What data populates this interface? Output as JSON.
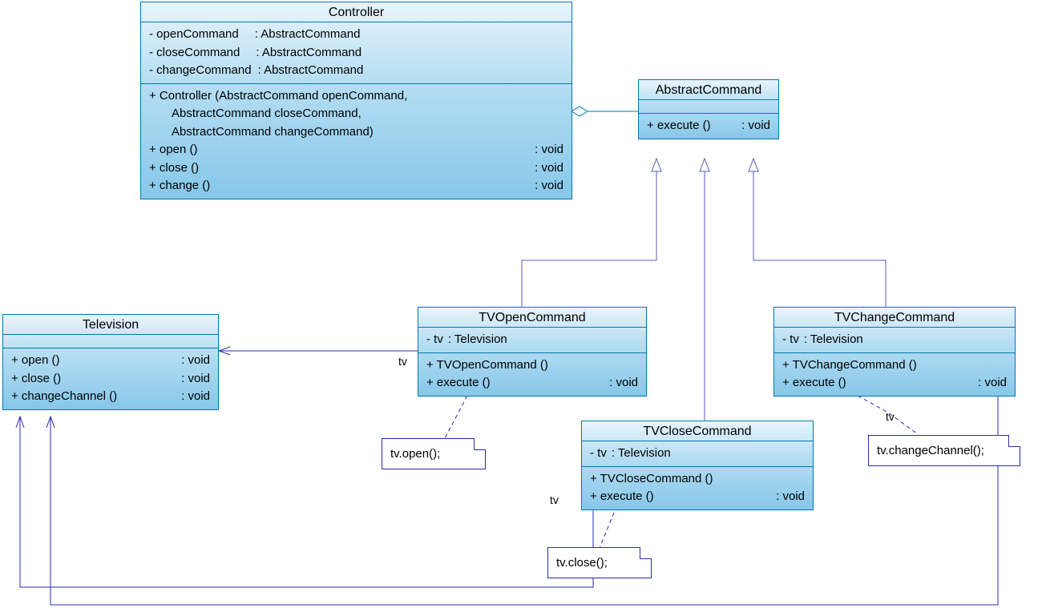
{
  "classes": {
    "controller": {
      "name": "Controller",
      "attrs": [
        {
          "text": "- openCommand",
          "type": ": AbstractCommand"
        },
        {
          "text": "- closeCommand",
          "type": ": AbstractCommand"
        },
        {
          "text": "- changeCommand",
          "type": ": AbstractCommand"
        }
      ],
      "ops": [
        {
          "text": "+ Controller (AbstractCommand openCommand,",
          "ret": ""
        },
        {
          "text": "AbstractCommand closeCommand,",
          "ret": "",
          "indent": true
        },
        {
          "text": "AbstractCommand changeCommand)",
          "ret": "",
          "indent": true
        },
        {
          "text": "+ open ()",
          "ret": ": void"
        },
        {
          "text": "+ close ()",
          "ret": ": void"
        },
        {
          "text": "+ change ()",
          "ret": ": void"
        }
      ]
    },
    "abstractCommand": {
      "name": "AbstractCommand",
      "ops": [
        {
          "text": "+ execute ()",
          "ret": ": void"
        }
      ]
    },
    "television": {
      "name": "Television",
      "ops": [
        {
          "text": "+ open ()",
          "ret": ": void"
        },
        {
          "text": "+ close ()",
          "ret": ": void"
        },
        {
          "text": "+ changeChannel ()",
          "ret": ": void"
        }
      ]
    },
    "tvOpen": {
      "name": "TVOpenCommand",
      "attrs": [
        {
          "text": "- tv",
          "type": ": Television"
        }
      ],
      "ops": [
        {
          "text": "+ TVOpenCommand ()",
          "ret": ""
        },
        {
          "text": "+ execute ()",
          "ret": ": void"
        }
      ]
    },
    "tvClose": {
      "name": "TVCloseCommand",
      "attrs": [
        {
          "text": "- tv",
          "type": ": Television"
        }
      ],
      "ops": [
        {
          "text": "+ TVCloseCommand ()",
          "ret": ""
        },
        {
          "text": "+ execute ()",
          "ret": ": void"
        }
      ]
    },
    "tvChange": {
      "name": "TVChangeCommand",
      "attrs": [
        {
          "text": "- tv",
          "type": ": Television"
        }
      ],
      "ops": [
        {
          "text": "+ TVChangeCommand ()",
          "ret": ""
        },
        {
          "text": "+ execute ()",
          "ret": ": void"
        }
      ]
    }
  },
  "notes": {
    "open": "tv.open();",
    "close": "tv.close();",
    "change": "tv.changeChannel();"
  },
  "labels": {
    "tv1": "tv",
    "tv2": "tv",
    "tv3": "tv"
  }
}
